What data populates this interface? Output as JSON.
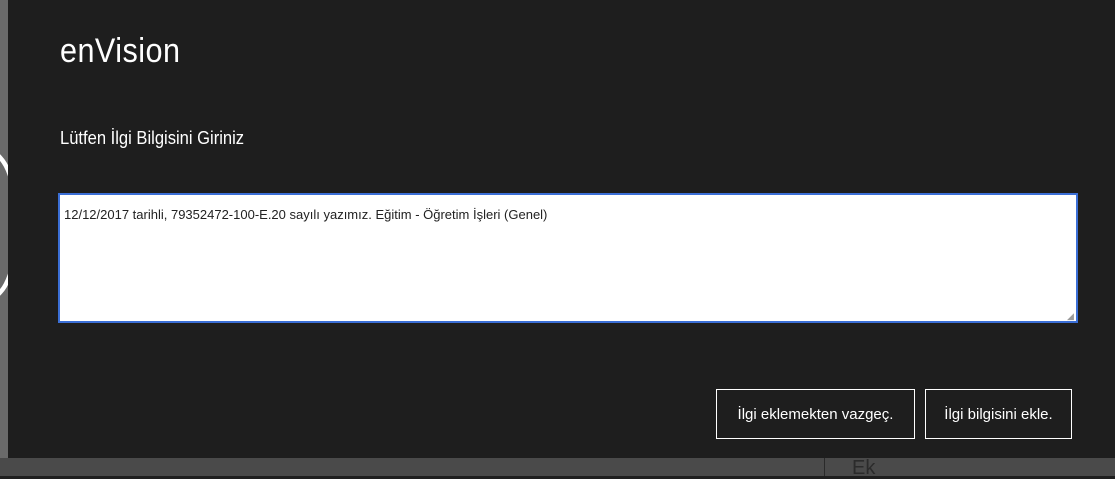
{
  "dialog": {
    "app_title": "enVision",
    "prompt": "Lütfen İlgi Bilgisini Giriniz",
    "input_value": "12/12/2017 tarihli, 79352472-100-E.20 sayılı yazımız. Eğitim - Öğretim İşleri (Genel)",
    "cancel_label": "İlgi eklemekten vazgeç.",
    "add_label": "İlgi bilgisini ekle."
  },
  "background": {
    "partial_text": "Ek"
  },
  "colors": {
    "dialog_bg": "#1e1e1e",
    "input_border": "#3b6fd6",
    "text_light": "#ffffff"
  },
  "icons": {
    "resize_grip": "resize-grip-icon"
  }
}
